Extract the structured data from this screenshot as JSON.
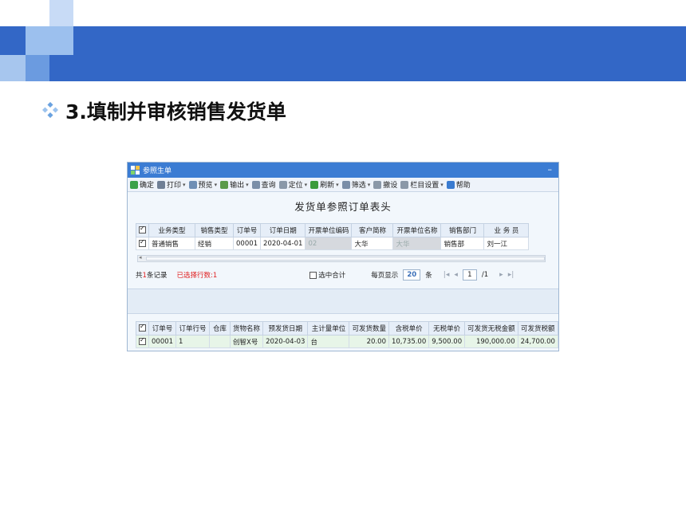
{
  "slide": {
    "title": "3.填制并审核销售发货单"
  },
  "window": {
    "title": "参照生单",
    "toolbar": [
      {
        "label": "确定",
        "icon": "check-icon",
        "color": "#3aa14a",
        "caret": false
      },
      {
        "label": "打印",
        "icon": "printer-icon",
        "color": "#6f7f95",
        "caret": true
      },
      {
        "label": "预览",
        "icon": "preview-icon",
        "color": "#6f8fb5",
        "caret": true
      },
      {
        "label": "输出",
        "icon": "export-icon",
        "color": "#5a9a4a",
        "caret": true
      },
      {
        "label": "查询",
        "icon": "query-icon",
        "color": "#7a8ea8",
        "caret": false
      },
      {
        "label": "定位",
        "icon": "locate-icon",
        "color": "#8a98a8",
        "caret": true
      },
      {
        "label": "刷新",
        "icon": "refresh-icon",
        "color": "#3b9b3b",
        "caret": true
      },
      {
        "label": "筛选",
        "icon": "filter-icon",
        "color": "#7a8ea8",
        "caret": true
      },
      {
        "label": "撤设",
        "icon": "undo-icon",
        "color": "#8a98a8",
        "caret": false
      },
      {
        "label": "栏目设置",
        "icon": "columns-icon",
        "color": "#8a98a8",
        "caret": true
      },
      {
        "label": "帮助",
        "icon": "help-icon",
        "color": "#3a7bd0",
        "caret": false
      }
    ],
    "form_title": "发货单参照订单表头",
    "header_table": {
      "columns": [
        "",
        "业务类型",
        "销售类型",
        "订单号",
        "订单日期",
        "开票单位编码",
        "客户简称",
        "开票单位名称",
        "销售部门",
        "业 务 员"
      ],
      "rows": [
        [
          "",
          "普通销售",
          "经销",
          "00001",
          "2020-04-01",
          "02",
          "大华",
          "大华",
          "销售部",
          "刘一江"
        ]
      ]
    },
    "status": {
      "total_prefix": "共",
      "total_count": "1",
      "total_suffix": "条记录",
      "selected_label": "已选择行数:1",
      "checkbox_label": "选中合计",
      "per_page_label": "每页显示",
      "per_page_value": "20",
      "per_page_unit": "条",
      "page_value": "1",
      "page_total": "/1"
    },
    "detail_table": {
      "columns": [
        "",
        "订单号",
        "订单行号",
        "仓库",
        "货物名称",
        "预发货日期",
        "主计量单位",
        "可发货数量",
        "含税单价",
        "无税单价",
        "可发货无税金额",
        "可发货税额"
      ],
      "rows": [
        [
          "",
          "00001",
          "1",
          "",
          "创智X号",
          "2020-04-03",
          "台",
          "20.00",
          "10,735.00",
          "9,500.00",
          "190,000.00",
          "24,700.00"
        ]
      ]
    }
  }
}
